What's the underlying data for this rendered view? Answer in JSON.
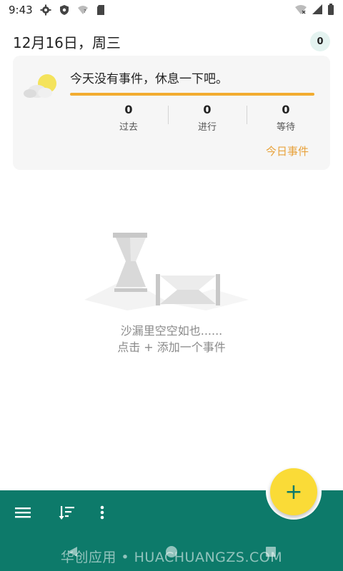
{
  "status_bar": {
    "time": "9:43"
  },
  "header": {
    "date": "12月16日，周三",
    "event_count": "0"
  },
  "summary_card": {
    "message": "今天没有事件，休息一下吧。",
    "stats": [
      {
        "value": "0",
        "label": "过去"
      },
      {
        "value": "0",
        "label": "进行"
      },
      {
        "value": "0",
        "label": "等待"
      }
    ],
    "today_link": "今日事件"
  },
  "empty_state": {
    "line1": "沙漏里空空如也......",
    "line2": "点击 + 添加一个事件"
  },
  "fab": {
    "label": "+"
  },
  "watermark": "华创应用 • HUACHUANGZS.COM",
  "colors": {
    "accent_green": "#0d7a6a",
    "fab_yellow": "#fadb37",
    "progress_orange": "#f2ac30",
    "link_orange": "#e8a23c"
  }
}
